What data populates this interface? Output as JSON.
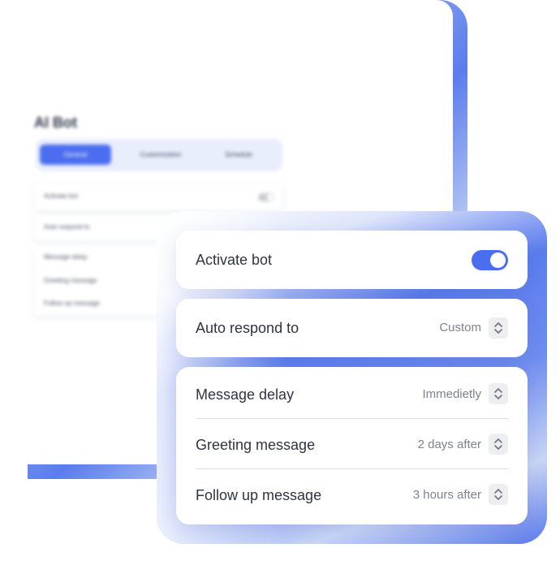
{
  "colors": {
    "accent": "#4b6ef0",
    "frame": "#5b7cee",
    "text": "#2f3443",
    "muted": "#7d8290"
  },
  "background_panel": {
    "title": "AI Bot",
    "tabs": [
      {
        "label": "General",
        "active": true
      },
      {
        "label": "Customization",
        "active": false
      },
      {
        "label": "Schedule",
        "active": false
      }
    ],
    "rows": [
      {
        "label": "Activate bot",
        "toggle_on": false
      },
      {
        "label": "Auto respond to"
      },
      {
        "label": "Message delay"
      },
      {
        "label": "Greeting message"
      },
      {
        "label": "Follow up message"
      }
    ]
  },
  "settings": {
    "activate_bot": {
      "label": "Activate bot",
      "toggle_on": true
    },
    "auto_respond": {
      "label": "Auto respond to",
      "value": "Custom"
    },
    "message_delay": {
      "label": "Message delay",
      "value": "Immedietly"
    },
    "greeting": {
      "label": "Greeting message",
      "value": "2 days after"
    },
    "follow_up": {
      "label": "Follow up message",
      "value": "3 hours after"
    }
  },
  "icons": {
    "stepper": "updown-chevron-icon"
  }
}
